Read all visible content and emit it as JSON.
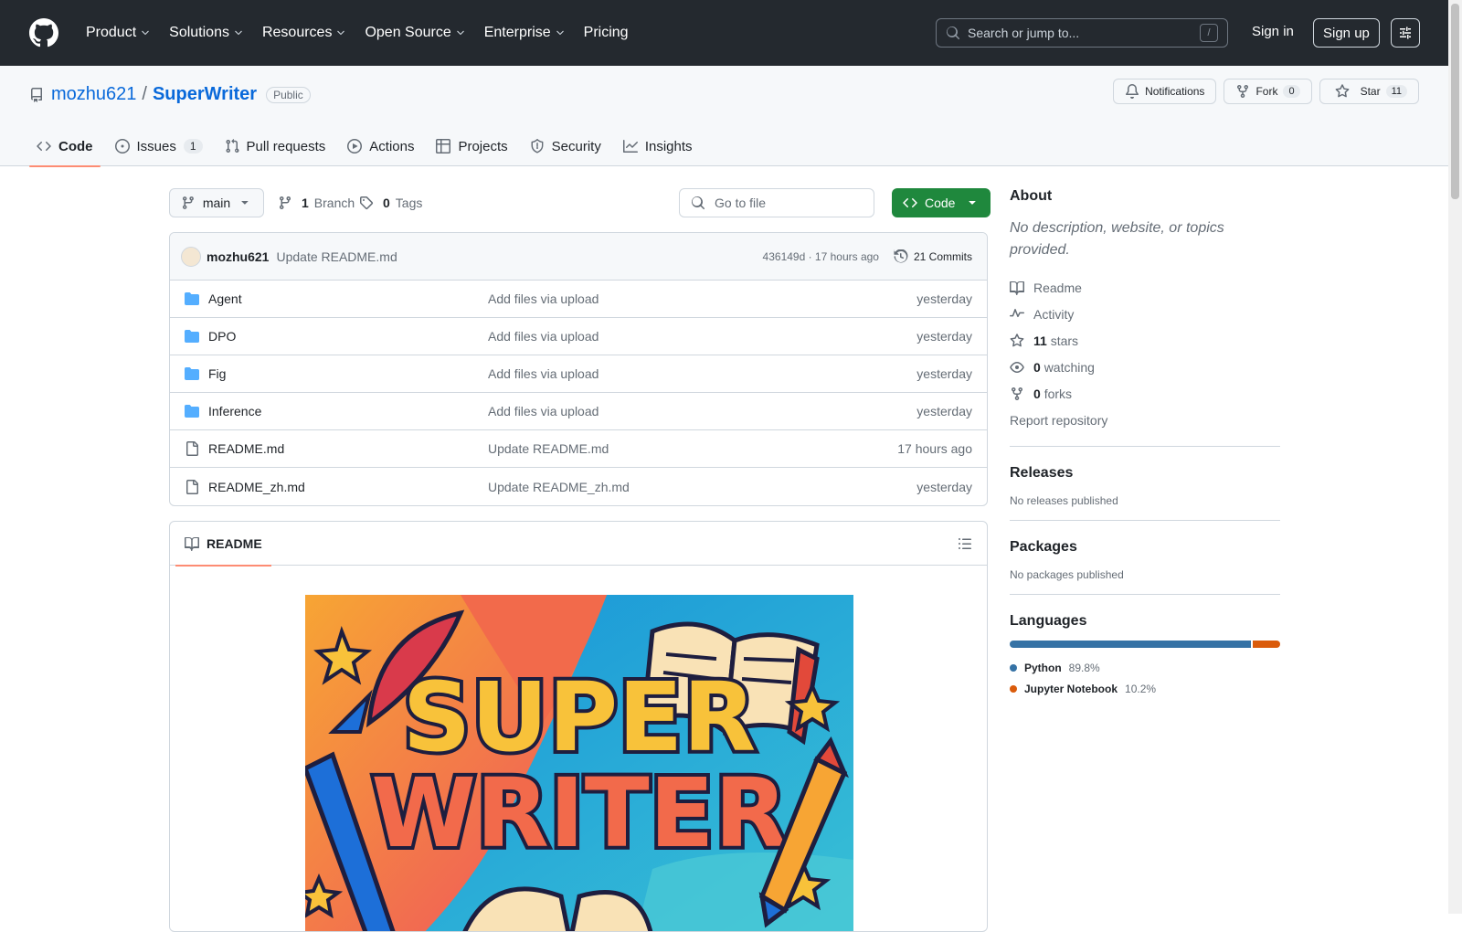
{
  "header": {
    "nav": [
      {
        "label": "Product",
        "dropdown": true
      },
      {
        "label": "Solutions",
        "dropdown": true
      },
      {
        "label": "Resources",
        "dropdown": true
      },
      {
        "label": "Open Source",
        "dropdown": true
      },
      {
        "label": "Enterprise",
        "dropdown": true
      },
      {
        "label": "Pricing",
        "dropdown": false
      }
    ],
    "search_placeholder": "Search or jump to...",
    "search_kbd": "/",
    "sign_in": "Sign in",
    "sign_up": "Sign up"
  },
  "repo": {
    "owner": "mozhu621",
    "sep": "/",
    "name": "SuperWriter",
    "visibility": "Public",
    "notifications_label": "Notifications",
    "fork_label": "Fork",
    "fork_count": "0",
    "star_label": "Star",
    "star_count": "11"
  },
  "tabs": [
    {
      "label": "Code",
      "icon": "code-icon",
      "count": ""
    },
    {
      "label": "Issues",
      "icon": "issue-icon",
      "count": "1"
    },
    {
      "label": "Pull requests",
      "icon": "pull-request-icon",
      "count": ""
    },
    {
      "label": "Actions",
      "icon": "play-icon",
      "count": ""
    },
    {
      "label": "Projects",
      "icon": "table-icon",
      "count": ""
    },
    {
      "label": "Security",
      "icon": "shield-icon",
      "count": ""
    },
    {
      "label": "Insights",
      "icon": "graph-icon",
      "count": ""
    }
  ],
  "toolbar": {
    "branch": "main",
    "branch_count": "1",
    "branch_label": "Branch",
    "tag_count": "0",
    "tag_label": "Tags",
    "goto_placeholder": "Go to file",
    "code_label": "Code"
  },
  "commit": {
    "author": "mozhu621",
    "message": "Update README.md",
    "sha_time": "436149d · 17 hours ago",
    "commits": "21 Commits"
  },
  "files": [
    {
      "name": "Agent",
      "type": "folder",
      "message": "Add files via upload",
      "date": "yesterday"
    },
    {
      "name": "DPO",
      "type": "folder",
      "message": "Add files via upload",
      "date": "yesterday"
    },
    {
      "name": "Fig",
      "type": "folder",
      "message": "Add files via upload",
      "date": "yesterday"
    },
    {
      "name": "Inference",
      "type": "folder",
      "message": "Add files via upload",
      "date": "yesterday"
    },
    {
      "name": "README.md",
      "type": "file",
      "message": "Update README.md",
      "date": "17 hours ago"
    },
    {
      "name": "README_zh.md",
      "type": "file",
      "message": "Update README_zh.md",
      "date": "yesterday"
    }
  ],
  "readme": {
    "tab_label": "README",
    "banner_line1": "SUPER",
    "banner_line2": "WRITER"
  },
  "sidebar": {
    "about_title": "About",
    "about_desc": "No description, website, or topics provided.",
    "links": {
      "readme": "Readme",
      "activity": "Activity",
      "stars_count": "11",
      "stars_label": "stars",
      "watching_count": "0",
      "watching_label": "watching",
      "forks_count": "0",
      "forks_label": "forks",
      "report": "Report repository"
    },
    "releases_title": "Releases",
    "releases_desc": "No releases published",
    "packages_title": "Packages",
    "packages_desc": "No packages published",
    "languages_title": "Languages",
    "languages": [
      {
        "name": "Python",
        "percent": "89.8%",
        "value": 89.8,
        "color": "#3572A5"
      },
      {
        "name": "Jupyter Notebook",
        "percent": "10.2%",
        "value": 10.2,
        "color": "#DA5B0B"
      }
    ]
  },
  "colors": {
    "header_bg": "#24292f",
    "accent_link": "#0969da",
    "code_button": "#1f883d",
    "active_tab_underline": "#fd8c73",
    "folder": "#54aeff"
  }
}
